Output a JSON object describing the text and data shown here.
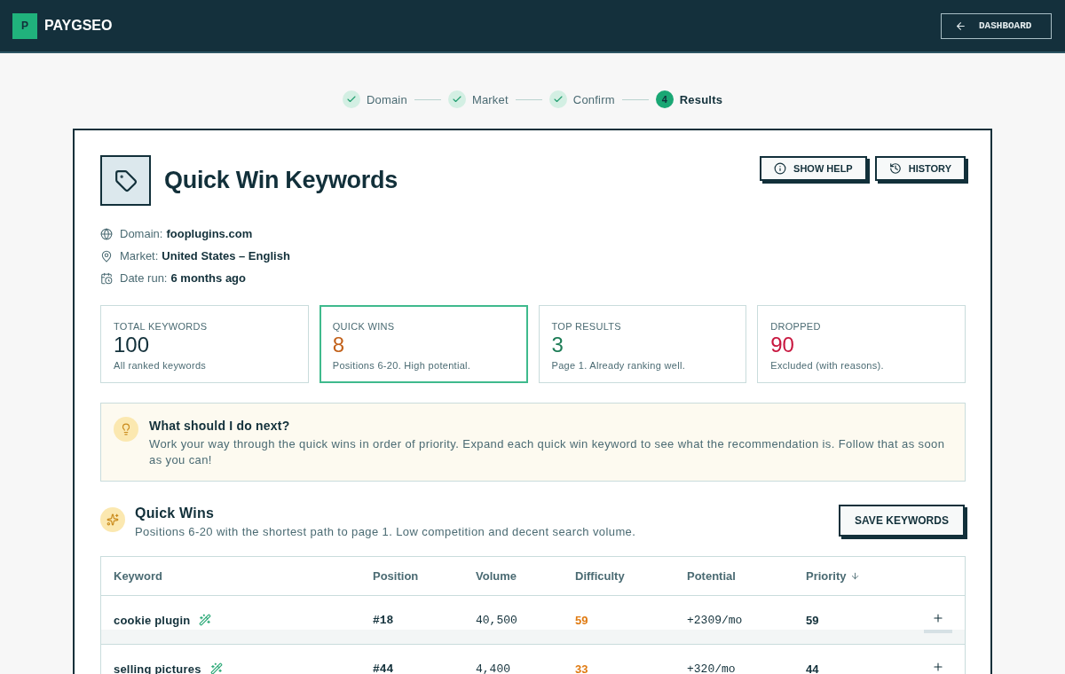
{
  "header": {
    "logo_letter": "P",
    "brand": "PAYGSEO",
    "dashboard_button": "DASHBOARD"
  },
  "stepper": [
    {
      "label": "Domain",
      "done": true,
      "selected": false
    },
    {
      "label": "Market",
      "done": true,
      "selected": false
    },
    {
      "label": "Confirm",
      "done": true,
      "selected": false
    },
    {
      "label": "Results",
      "done": false,
      "selected": true,
      "number": "4"
    }
  ],
  "report": {
    "title": "Quick Win Keywords",
    "actions": [
      "SHOW HELP",
      "HISTORY"
    ],
    "meta": [
      {
        "label": "Domain:",
        "value": "fooplugins.com"
      },
      {
        "label": "Market:",
        "value": "United States – English"
      },
      {
        "label": "Date run:",
        "value": "6 months ago"
      }
    ],
    "stats": [
      {
        "label": "TOTAL KEYWORDS",
        "value": "100",
        "note": "All ranked keywords",
        "color": "#12303a",
        "selected": false
      },
      {
        "label": "QUICK WINS",
        "value": "8",
        "note": "Positions 6-20. High potential.",
        "color": "#c2611a",
        "selected": true
      },
      {
        "label": "TOP RESULTS",
        "value": "3",
        "note": "Page 1. Already ranking well.",
        "color": "#1e7d57",
        "selected": false
      },
      {
        "label": "DROPPED",
        "value": "90",
        "note": "Excluded (with reasons).",
        "color": "#c8173f",
        "selected": false
      }
    ],
    "tip": {
      "title": "What should I do next?",
      "text": "Work your way through the quick wins in order of priority. Expand each quick win keyword to see what the recommendation is. Follow that as soon as you can!"
    }
  },
  "quick_wins": {
    "title": "Quick Wins",
    "subtitle": "Positions 6-20 with the shortest path to page 1. Low competition and decent search volume.",
    "save_button": "SAVE KEYWORDS",
    "table": {
      "columns": [
        {
          "label": "Keyword",
          "sorted": false
        },
        {
          "label": "Position",
          "sorted": false
        },
        {
          "label": "Volume",
          "sorted": false
        },
        {
          "label": "Difficulty",
          "sorted": false
        },
        {
          "label": "Potential",
          "sorted": false
        },
        {
          "label": "Priority",
          "sorted": true
        }
      ],
      "rows": [
        {
          "keyword": "cookie plugin",
          "position": "#18",
          "volume": "40,500",
          "difficulty": "59",
          "potential": "+2309/mo",
          "priority": "59",
          "expanded": false
        },
        {
          "keyword": "selling pictures",
          "position": "#44",
          "volume": "4,400",
          "difficulty": "33",
          "potential": "+320/mo",
          "priority": "44",
          "expanded": false
        }
      ]
    }
  }
}
